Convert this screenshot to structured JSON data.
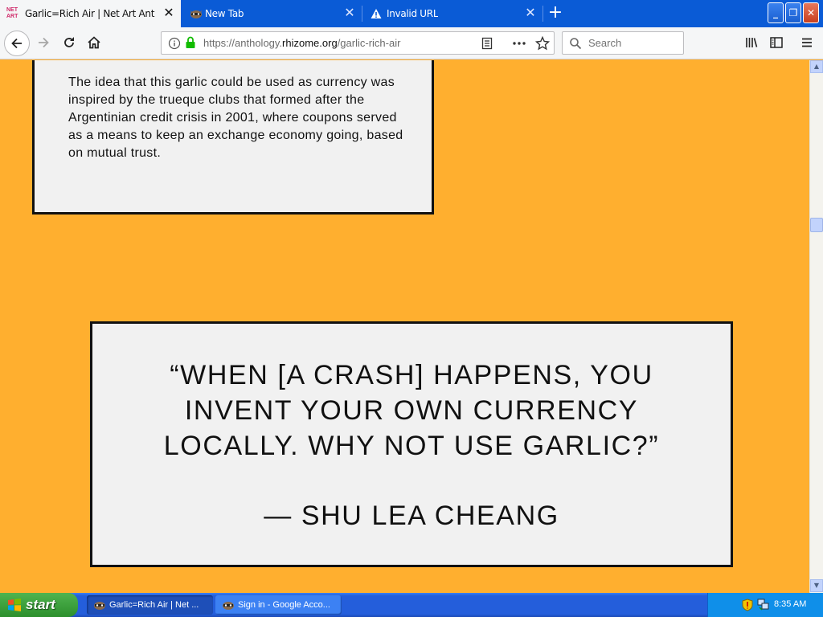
{
  "browser": {
    "tabs": [
      {
        "label": "Garlic=Rich Air | Net Art Antholog",
        "favicon": "netart-icon",
        "favicon_text": "NET ART",
        "active": true
      },
      {
        "label": "New Tab",
        "favicon": "raccoon-icon",
        "active": false
      },
      {
        "label": "Invalid URL",
        "favicon": "warning-icon",
        "active": false
      }
    ],
    "new_tab_symbol": "+",
    "window_controls": {
      "minimize": "_",
      "restore": "❐",
      "close": "✕"
    },
    "url": {
      "prefix": "https://anthology.",
      "host": "rhizome.org",
      "path": "/garlic-rich-air"
    },
    "search_placeholder": "Search"
  },
  "page": {
    "paragraph": "The idea that this garlic could be used as currency was inspired by the trueque clubs that formed after the Argentinian credit crisis in 2001, where coupons served as a means to keep an exchange economy going, based on mutual trust.",
    "quote": "“WHEN [A CRASH] HAPPENS, YOU INVENT YOUR OWN CURRENCY LOCALLY. WHY NOT USE GARLIC?”",
    "author": "— SHU LEA CHEANG",
    "background_color": "#ffaf2f"
  },
  "taskbar": {
    "start_label": "start",
    "items": [
      {
        "label": "Garlic=Rich Air | Net ...",
        "active": true
      },
      {
        "label": "Sign in - Google Acco...",
        "active": false
      }
    ],
    "clock": "8:35 AM"
  }
}
